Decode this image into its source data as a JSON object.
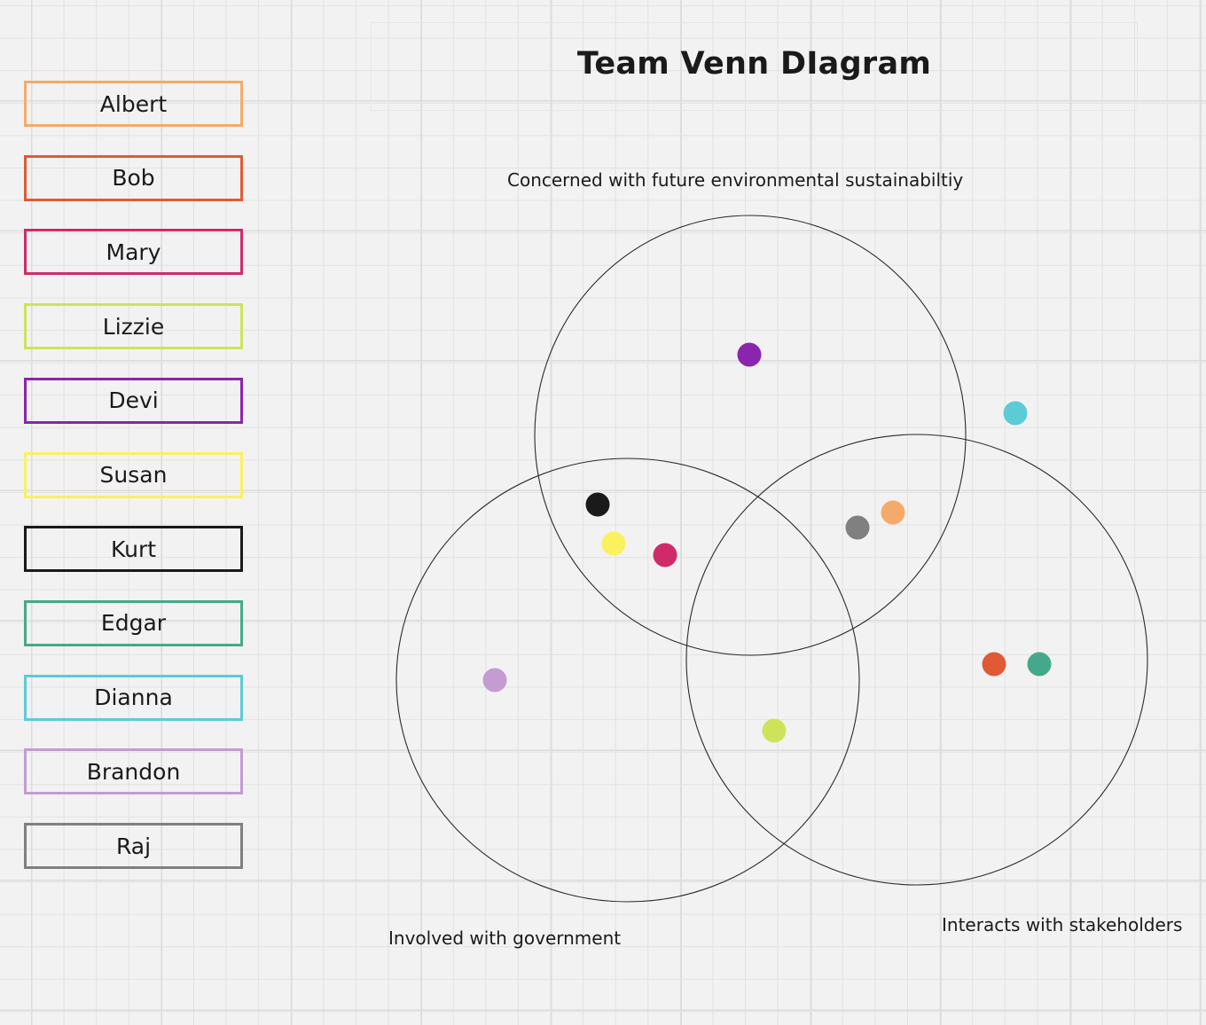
{
  "title": "Team Venn DIagram",
  "people": [
    {
      "name": "Albert",
      "color": "#f5aa6a",
      "region": "environment-stakeholders"
    },
    {
      "name": "Bob",
      "color": "#e05a36",
      "region": "stakeholders-only"
    },
    {
      "name": "Mary",
      "color": "#cf2b6a",
      "region": "environment-government"
    },
    {
      "name": "Lizzie",
      "color": "#cfe35a",
      "region": "government-stakeholders"
    },
    {
      "name": "Devi",
      "color": "#8b25ad",
      "region": "environment-only"
    },
    {
      "name": "Susan",
      "color": "#faf15f",
      "region": "environment-government"
    },
    {
      "name": "Kurt",
      "color": "#1a1a1a",
      "region": "environment-government"
    },
    {
      "name": "Edgar",
      "color": "#46a88a",
      "region": "stakeholders-only"
    },
    {
      "name": "Dianna",
      "color": "#5ccbd6",
      "region": "outside"
    },
    {
      "name": "Brandon",
      "color": "#c49bd2",
      "region": "government-only"
    },
    {
      "name": "Raj",
      "color": "#808080",
      "region": "environment-stakeholders"
    }
  ],
  "sets": [
    {
      "id": "environment",
      "label": "Concerned with future environmental sustainabiltiy"
    },
    {
      "id": "government",
      "label": "Involved with government"
    },
    {
      "id": "stakeholders",
      "label": "Interacts with stakeholders"
    }
  ]
}
